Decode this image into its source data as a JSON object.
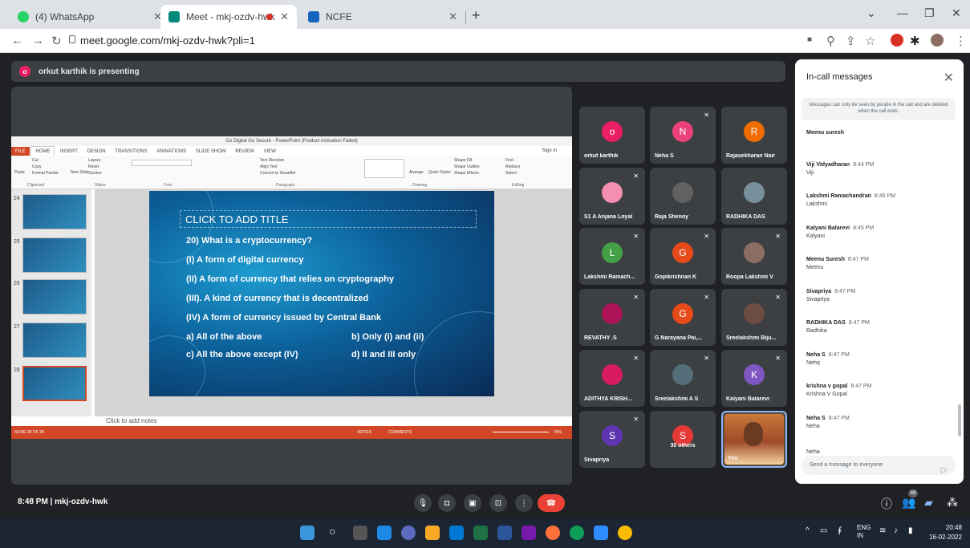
{
  "browser": {
    "tabs": [
      {
        "label": "(4) WhatsApp",
        "color": "#25d366"
      },
      {
        "label": "Meet - mkj-ozdv-hwk",
        "color": "#00897b"
      },
      {
        "label": "NCFE",
        "color": "#1565c0"
      }
    ],
    "url": "meet.google.com/mkj-ozdv-hwk?pli=1",
    "new_tab": "+",
    "minimize": "—",
    "restore": "❐",
    "close": "✕"
  },
  "banner": {
    "initial": "o",
    "text": "orkut karthik is presenting"
  },
  "ppt": {
    "window_title": "Go Digital Go Secure - PowerPoint (Product Activation Failed)",
    "tabs": [
      "FILE",
      "HOME",
      "INSERT",
      "DESIGN",
      "TRANSITIONS",
      "ANIMATIONS",
      "SLIDE SHOW",
      "REVIEW",
      "VIEW"
    ],
    "sign_in": "Sign in",
    "ribbon_groups": [
      "Clipboard",
      "Slides",
      "Font",
      "Paragraph",
      "Drawing",
      "Editing"
    ],
    "ribbon_items": {
      "cut": "Cut",
      "copy": "Copy",
      "paste": "Paste",
      "format_painter": "Format Painter",
      "new_slide": "New Slide",
      "layout": "Layout",
      "reset": "Reset",
      "section": "Section",
      "text_direction": "Text Direction",
      "align_text": "Align Text",
      "convert_smartart": "Convert to SmartArt",
      "arrange": "Arrange",
      "quick_styles": "Quick Styles",
      "shape_fill": "Shape Fill",
      "shape_outline": "Shape Outline",
      "shape_effects": "Shape Effects",
      "find": "Find",
      "replace": "Replace",
      "select": "Select"
    },
    "thumb_numbers": [
      "24",
      "25",
      "26",
      "27",
      "28"
    ],
    "slide": {
      "title": "CLICK TO ADD TITLE",
      "question": "20) What is a cryptocurrency?",
      "options": [
        "(I) A form of digital currency",
        "(II) A form of currency that relies on cryptography",
        "(III). A kind of currency that is decentralized",
        "(IV) A form of currency issued by Central Bank"
      ],
      "answers": [
        "a) All of the above",
        "b) Only (i) and (ii)",
        "c) All the above except (IV)",
        "d) II and III only"
      ]
    },
    "notes": "Click to add notes",
    "status_left": "SLIDE 28 OF 28",
    "status_notes": "NOTES",
    "status_comments": "COMMENTS",
    "zoom": "76%"
  },
  "participants": [
    {
      "name": "orkut karthik",
      "initial": "o",
      "color": "#e91e63",
      "muted": false
    },
    {
      "name": "Neha S",
      "initial": "N",
      "color": "#ec407a",
      "muted": true
    },
    {
      "name": "Rajasekharan Nair",
      "initial": "R",
      "color": "#ef6c00",
      "muted": false
    },
    {
      "name": "S1 A Anjana Loyal",
      "initial": "",
      "color": "#f48fb1",
      "muted": true
    },
    {
      "name": "Raja Shenoy",
      "initial": "",
      "color": "#616161",
      "muted": false
    },
    {
      "name": "RADHIKA DAS",
      "initial": "",
      "color": "#78909c",
      "muted": false
    },
    {
      "name": "Lakshmi Ramach...",
      "initial": "L",
      "color": "#43a047",
      "muted": true
    },
    {
      "name": "Gopikrishnan K",
      "initial": "G",
      "color": "#e64a19",
      "muted": true
    },
    {
      "name": "Roopa Lakshmi V",
      "initial": "",
      "color": "#8d6e63",
      "muted": true
    },
    {
      "name": "REVATHY .S",
      "initial": "",
      "color": "#ad1457",
      "muted": true
    },
    {
      "name": "G Narayana Pai,...",
      "initial": "G",
      "color": "#e64a19",
      "muted": true
    },
    {
      "name": "Sreelakshmi Biju...",
      "initial": "",
      "color": "#6d4c41",
      "muted": true
    },
    {
      "name": "ADITHYA KRISH...",
      "initial": "",
      "color": "#d81b60",
      "muted": true
    },
    {
      "name": "Sreelakshmi A S",
      "initial": "",
      "color": "#546e7a",
      "muted": true
    },
    {
      "name": "Kalyani Balarevi",
      "initial": "K",
      "color": "#7e57c2",
      "muted": true
    },
    {
      "name": "Sivapriya",
      "initial": "S",
      "color": "#5e35b1",
      "muted": true
    },
    {
      "name": "30 others",
      "initial": "S",
      "color": "#e53935",
      "muted": false
    },
    {
      "name": "You",
      "initial": "",
      "color": "",
      "muted": false
    }
  ],
  "chat": {
    "title": "In-call messages",
    "notice": "Messages can only be seen by people in the call and are deleted when the call ends.",
    "messages": [
      {
        "sender": "Meenu suresh",
        "time": "",
        "body": ""
      },
      {
        "sender": "Viji Vidyadharan",
        "time": "8:44 PM",
        "body": "Viji"
      },
      {
        "sender": "Lakshmi Ramachandran",
        "time": "8:45 PM",
        "body": "Lakshmi"
      },
      {
        "sender": "Kalyani Balarevi",
        "time": "8:45 PM",
        "body": "Kalyani"
      },
      {
        "sender": "Meenu Suresh",
        "time": "8:47 PM",
        "body": "Meenu"
      },
      {
        "sender": "Sivapriya",
        "time": "8:47 PM",
        "body": "Sivapriya"
      },
      {
        "sender": "RADHIKA DAS",
        "time": "8:47 PM",
        "body": "Radhika"
      },
      {
        "sender": "Neha S",
        "time": "8:47 PM",
        "body": "Nehq"
      },
      {
        "sender": "krishna v gopal",
        "time": "8:47 PM",
        "body": "Krishna V Gopal"
      },
      {
        "sender": "Neha S",
        "time": "8:47 PM",
        "body": "Neha"
      },
      {
        "sender": "",
        "time": "",
        "body": "Neha"
      }
    ],
    "input_placeholder": "Send a message to everyone"
  },
  "bottom": {
    "time_code": "8:48 PM  |  mkj-ozdv-hwk",
    "people_count": "48"
  },
  "taskbar": {
    "lang_top": "ENG",
    "lang_bottom": "IN",
    "clock_time": "20:48",
    "clock_date": "16-02-2022"
  }
}
